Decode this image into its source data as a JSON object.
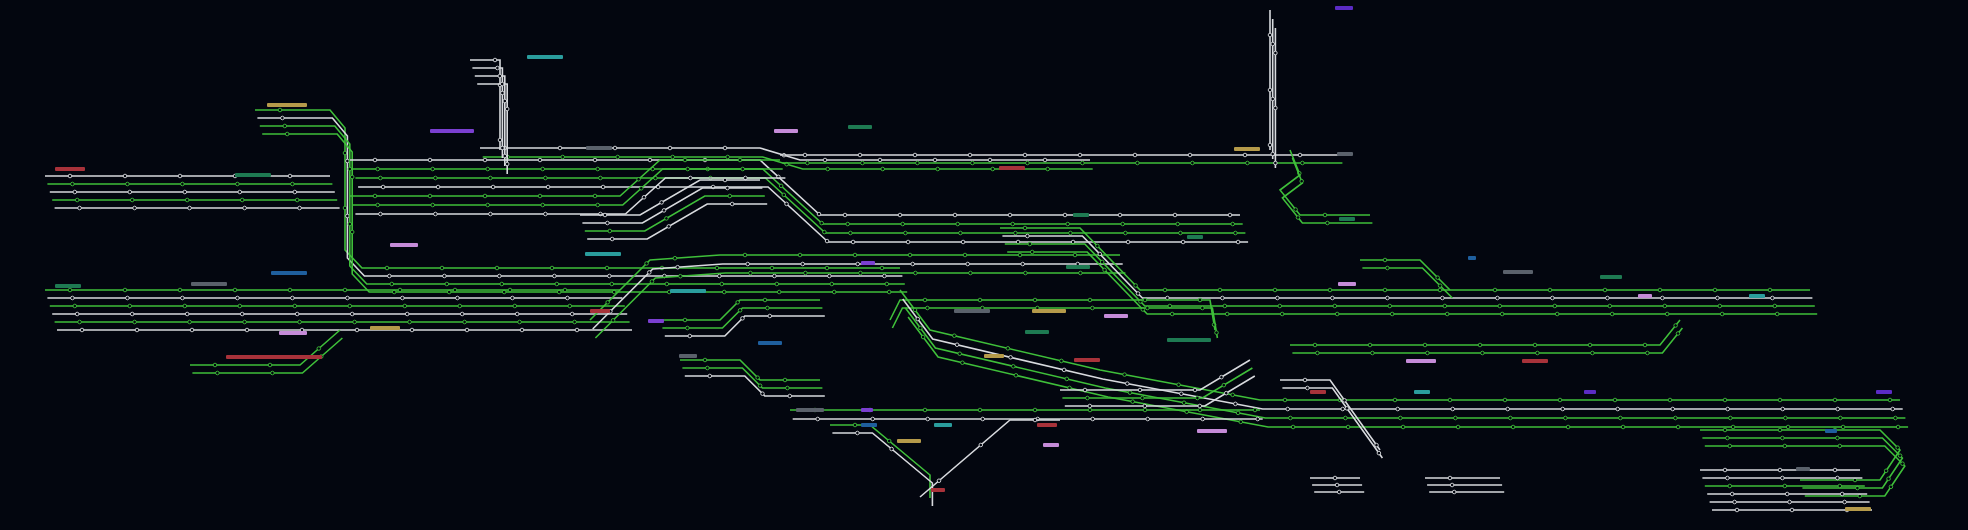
{
  "diagram": {
    "labels": [
      {
        "color": "#b59a4a"
      },
      {
        "color": "#2a9d9d"
      },
      {
        "color": "#7a3fd0"
      },
      {
        "color": "#5a616b"
      },
      {
        "color": "#c58bd8"
      },
      {
        "color": "#1e7a52"
      },
      {
        "color": "#a8323a"
      },
      {
        "color": "#a8323a"
      },
      {
        "color": "#1e7a52"
      },
      {
        "color": "#c58bd8"
      },
      {
        "color": "#2a9d9d"
      },
      {
        "color": "#1e7a52"
      },
      {
        "color": "#5a616b"
      },
      {
        "color": "#1f5f9e"
      },
      {
        "color": "#c58bd8"
      },
      {
        "color": "#b59a4a"
      },
      {
        "color": "#a8323a"
      },
      {
        "color": "#a8323a"
      },
      {
        "color": "#2a9d9d"
      },
      {
        "color": "#7a3fd0"
      },
      {
        "color": "#5a616b"
      },
      {
        "color": "#1f5f9e"
      },
      {
        "color": "#7a3fd0"
      },
      {
        "color": "#5a616b"
      },
      {
        "color": "#b59a4a"
      },
      {
        "color": "#1e7a52"
      },
      {
        "color": "#1e7a52"
      },
      {
        "color": "#1e7a52"
      },
      {
        "color": "#c58bd8"
      },
      {
        "color": "#b59a4a"
      },
      {
        "color": "#a8323a"
      },
      {
        "color": "#1e7a52"
      },
      {
        "color": "#1e7a52"
      },
      {
        "color": "#b59a4a"
      },
      {
        "color": "#5b2bc4"
      },
      {
        "color": "#5a616b"
      },
      {
        "color": "#1e7a52"
      },
      {
        "color": "#c58bd8"
      },
      {
        "color": "#1f5f9e"
      },
      {
        "color": "#5a616b"
      },
      {
        "color": "#1e7a52"
      },
      {
        "color": "#c58bd8"
      },
      {
        "color": "#2a9d9d"
      },
      {
        "color": "#c58bd8"
      },
      {
        "color": "#a8323a"
      },
      {
        "color": "#a8323a"
      },
      {
        "color": "#2a9d9d"
      },
      {
        "color": "#5b2bc4"
      },
      {
        "color": "#5b2bc4"
      },
      {
        "color": "#5a616b"
      },
      {
        "color": "#7a3fd0"
      },
      {
        "color": "#1f5f9e"
      },
      {
        "color": "#2a9d9d"
      },
      {
        "color": "#a8323a"
      },
      {
        "color": "#b59a4a"
      },
      {
        "color": "#c58bd8"
      },
      {
        "color": "#c58bd8"
      },
      {
        "color": "#a8323a"
      },
      {
        "color": "#1f5f9e"
      },
      {
        "color": "#5a616b"
      },
      {
        "color": "#b59a4a"
      }
    ]
  }
}
